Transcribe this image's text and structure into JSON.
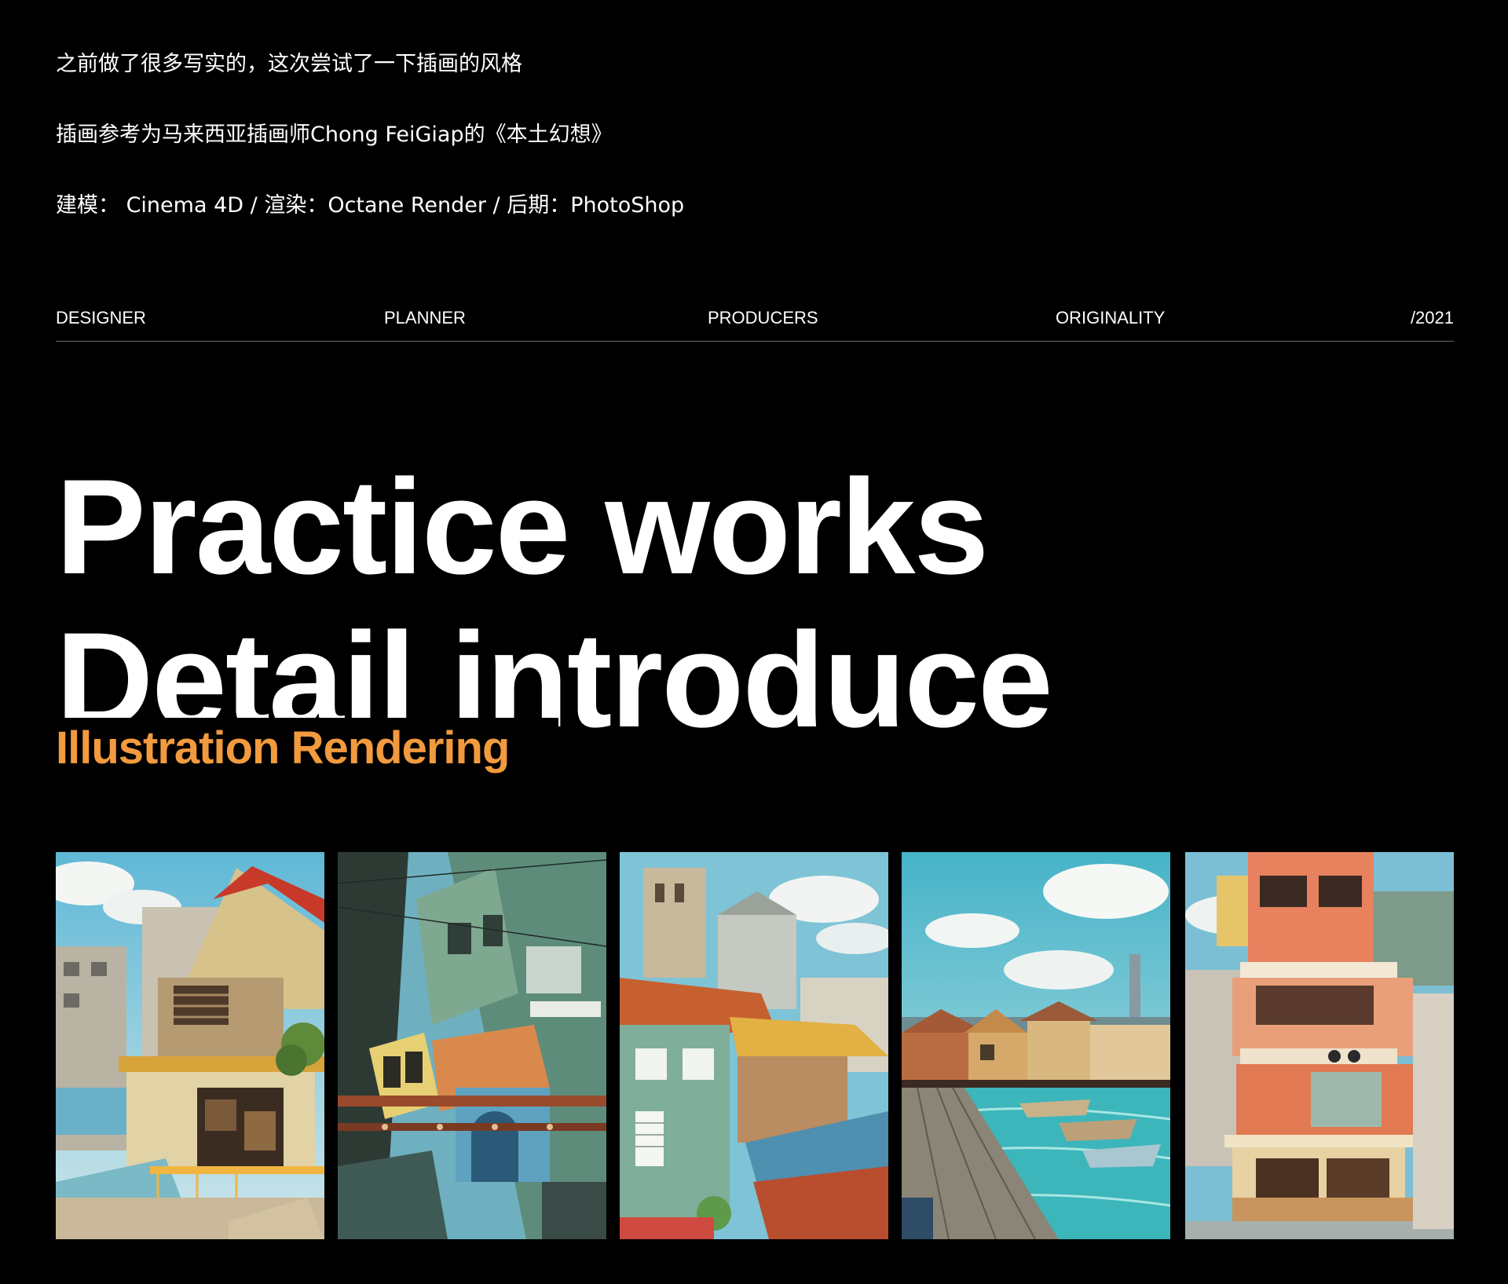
{
  "intro": {
    "line1": "之前做了很多写实的，这次尝试了一下插画的风格",
    "line2": "插画参考为马来西亚插画师Chong FeiGiap的《本土幻想》",
    "line3": "建模： Cinema 4D / 渲染：Octane Render / 后期：PhotoShop"
  },
  "meta": {
    "designer": "DESIGNER",
    "planner": "PLANNER",
    "producers": "PRODUCERS",
    "originality": "ORIGINALITY",
    "year": "/2021"
  },
  "headline": {
    "line1": "Practice works",
    "line2": "Detail introduce",
    "subtitle": "Illustration Rendering"
  },
  "colors": {
    "background": "#000000",
    "text": "#ffffff",
    "accent": "#f19a3e",
    "divider": "#6b6b6b"
  },
  "gallery": [
    {
      "name": "illustration-house-red-roof"
    },
    {
      "name": "illustration-tram-street"
    },
    {
      "name": "illustration-rooftops"
    },
    {
      "name": "illustration-harbor-boats"
    },
    {
      "name": "illustration-shophouse-tower"
    }
  ]
}
